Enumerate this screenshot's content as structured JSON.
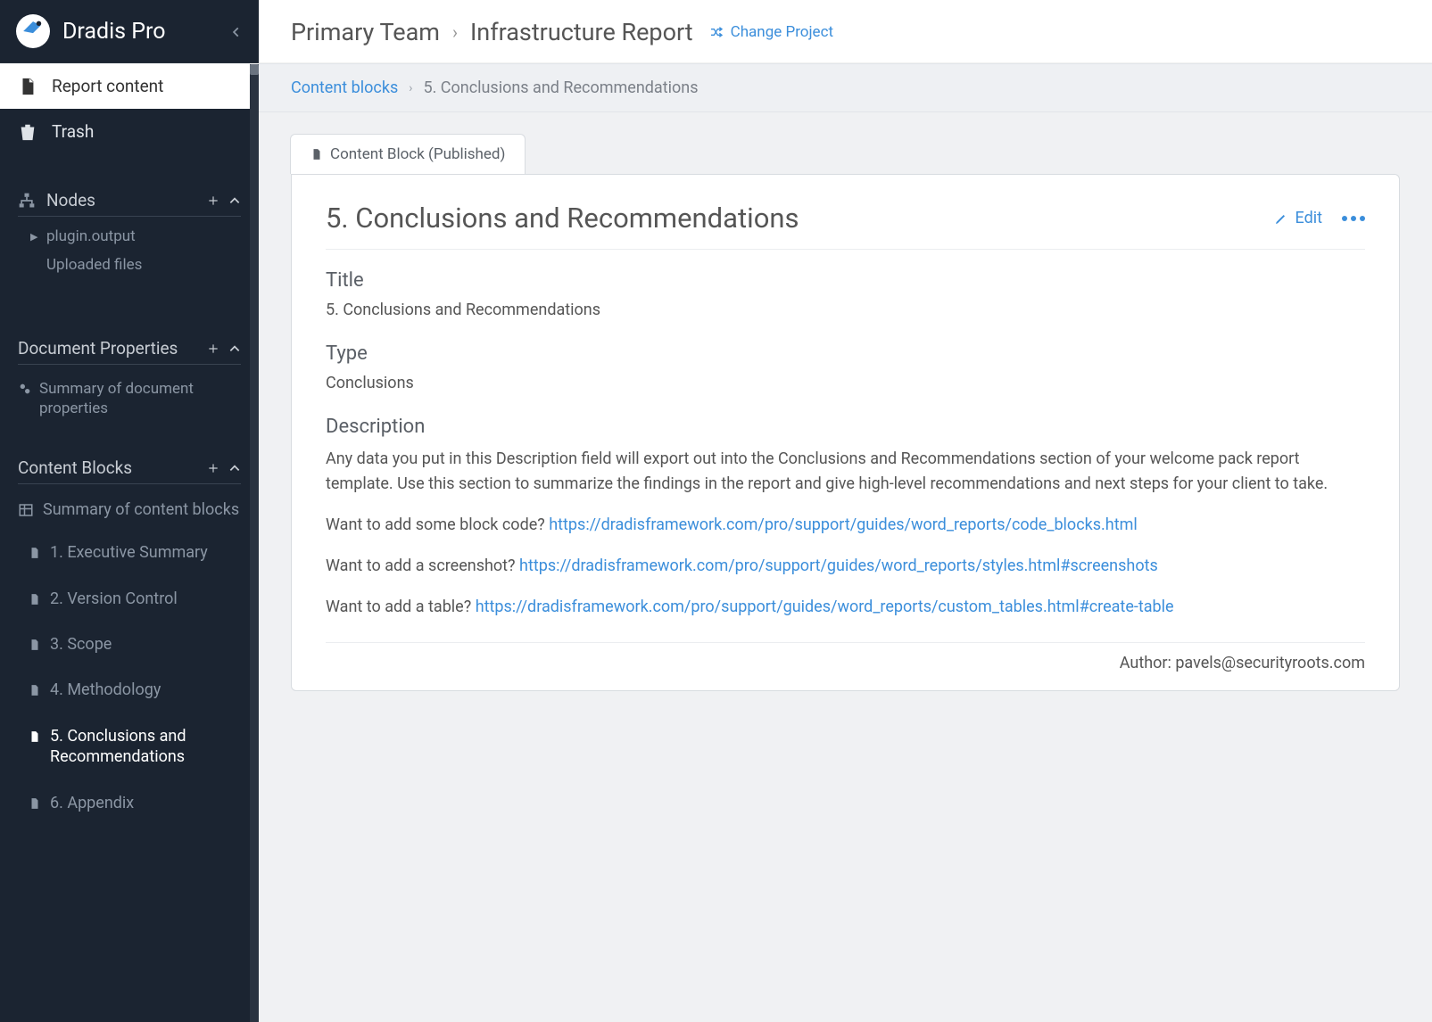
{
  "app_name": "Dradis Pro",
  "sidebar": {
    "top": [
      {
        "label": "Report content",
        "icon": "file",
        "active": true
      },
      {
        "label": "Trash",
        "icon": "trash",
        "active": false
      }
    ],
    "nodes_title": "Nodes",
    "nodes": [
      {
        "label": "plugin.output",
        "caret": true
      },
      {
        "label": "Uploaded files",
        "caret": false
      }
    ],
    "docprops_title": "Document Properties",
    "docprops_summary": "Summary of document properties",
    "cb_title": "Content Blocks",
    "cb_summary": "Summary of content blocks",
    "cb_items": [
      {
        "label": "1. Executive Summary"
      },
      {
        "label": "2. Version Control"
      },
      {
        "label": "3. Scope"
      },
      {
        "label": "4. Methodology"
      },
      {
        "label": "5. Conclusions and Recommendations",
        "active": true
      },
      {
        "label": "6. Appendix"
      }
    ]
  },
  "header": {
    "team": "Primary Team",
    "project": "Infrastructure Report",
    "change": "Change Project"
  },
  "breadcrumb": {
    "root": "Content blocks",
    "leaf": "5. Conclusions and Recommendations"
  },
  "tab_label": "Content Block (Published)",
  "page": {
    "heading": "5. Conclusions and Recommendations",
    "edit": "Edit",
    "title_label": "Title",
    "title_value": "5. Conclusions and Recommendations",
    "type_label": "Type",
    "type_value": "Conclusions",
    "desc_label": "Description",
    "desc_para": "Any data you put in this Description field will export out into the Conclusions and Recommendations section of your welcome pack report template. Use this section to summarize the findings in the report and give high-level recommendations and next steps for your client to take.",
    "q1_text": "Want to add some block code? ",
    "q1_link": "https://dradisframework.com/pro/support/guides/word_reports/code_blocks.html",
    "q2_text": "Want to add a screenshot? ",
    "q2_link": "https://dradisframework.com/pro/support/guides/word_reports/styles.html#screenshots",
    "q3_text": "Want to add a table? ",
    "q3_link": "https://dradisframework.com/pro/support/guides/word_reports/custom_tables.html#create-table",
    "author_label": "Author: ",
    "author_value": "pavels@securityroots.com"
  }
}
